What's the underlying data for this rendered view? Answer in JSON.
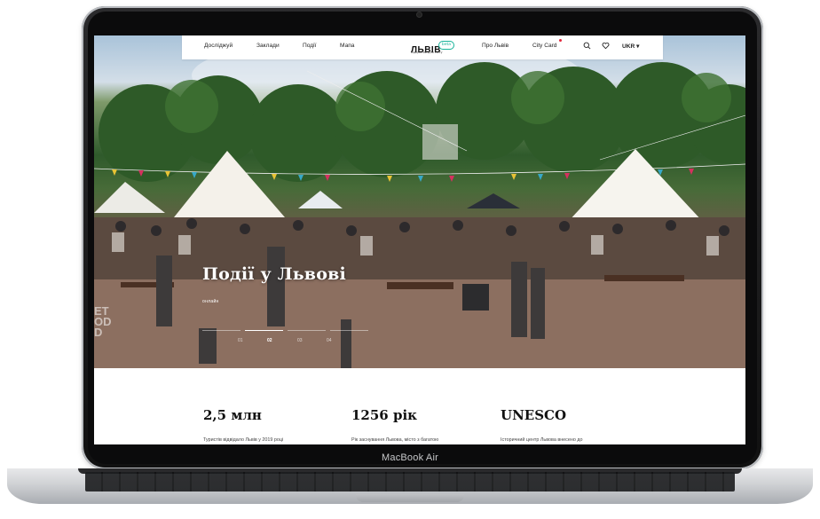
{
  "device": {
    "label": "MacBook Air"
  },
  "nav": {
    "left_items": [
      "Досліджуй",
      "Заклади",
      "Події",
      "Мапа"
    ],
    "logo": {
      "word": "ЛЬВІВ",
      "subtitle": "відкритий для світу",
      "badge": "beta"
    },
    "right_items": [
      "Про Львів",
      "City Card"
    ],
    "language": "UKR ▾"
  },
  "hero": {
    "title": "Події у Львові",
    "tag": "онлайн",
    "pager": [
      "01",
      "02",
      "03",
      "04"
    ],
    "active_page": 1
  },
  "stats": [
    {
      "value": "2,5 млн",
      "desc": "Туристів відвідало Львів у 2019 році"
    },
    {
      "value": "1256 рік",
      "desc": "Рік заснування Львова, місто з багатою"
    },
    {
      "value": "UNESCO",
      "desc": "Історичний центр Львова внесено до"
    }
  ],
  "colors": {
    "accent": "#19b39a",
    "alert": "#e2263a"
  },
  "icons": [
    "search-icon",
    "heart-icon",
    "chevron-down-icon"
  ]
}
